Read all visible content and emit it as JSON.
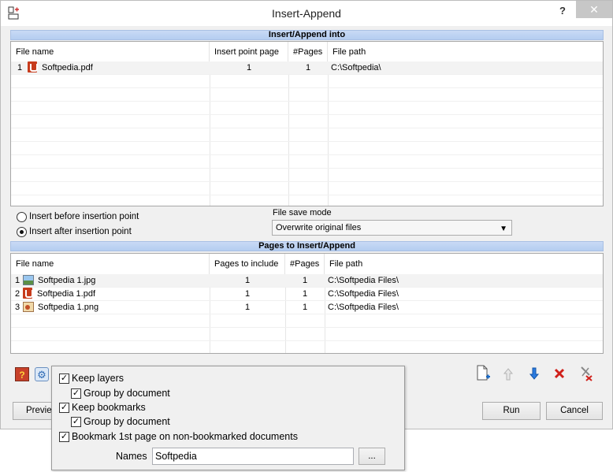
{
  "window": {
    "title": "Insert-Append",
    "help_label": "?",
    "close_label": "✕"
  },
  "top_section": {
    "header": "Insert/Append into",
    "columns": [
      "File name",
      "Insert point page",
      "#Pages",
      "File path"
    ],
    "rows": [
      {
        "index": "1",
        "icon": "pdf-icon",
        "name": "Softpedia.pdf",
        "insert_page": "1",
        "pages": "1",
        "path": "C:\\Softpedia\\"
      }
    ]
  },
  "insert_options": {
    "before_label": "Insert before insertion point",
    "after_label": "Insert after insertion point",
    "selected": "after"
  },
  "save_mode": {
    "label": "File save mode",
    "value": "Overwrite original files"
  },
  "bottom_section": {
    "header": "Pages to Insert/Append",
    "columns": [
      "File name",
      "Pages to include",
      "#Pages",
      "File path"
    ],
    "rows": [
      {
        "index": "1",
        "icon": "jpg-icon",
        "name": "Softpedia 1.jpg",
        "include": "1",
        "pages": "1",
        "path": "C:\\Softpedia Files\\"
      },
      {
        "index": "2",
        "icon": "pdf-icon",
        "name": "Softpedia 1.pdf",
        "include": "1",
        "pages": "1",
        "path": "C:\\Softpedia Files\\"
      },
      {
        "index": "3",
        "icon": "png-icon",
        "name": "Softpedia 1.png",
        "include": "1",
        "pages": "1",
        "path": "C:\\Softpedia Files\\"
      }
    ]
  },
  "buttons": {
    "preview": "Preview",
    "run": "Run",
    "cancel": "Cancel",
    "browse": "..."
  },
  "popup": {
    "keep_layers": "Keep layers",
    "group_by_document_1": "Group by document",
    "keep_bookmarks": "Keep bookmarks",
    "group_by_document_2": "Group by document",
    "bookmark_first_page": "Bookmark 1st page on non-bookmarked documents",
    "names_label": "Names",
    "names_value": "Softpedia",
    "check_mark": "✓"
  }
}
